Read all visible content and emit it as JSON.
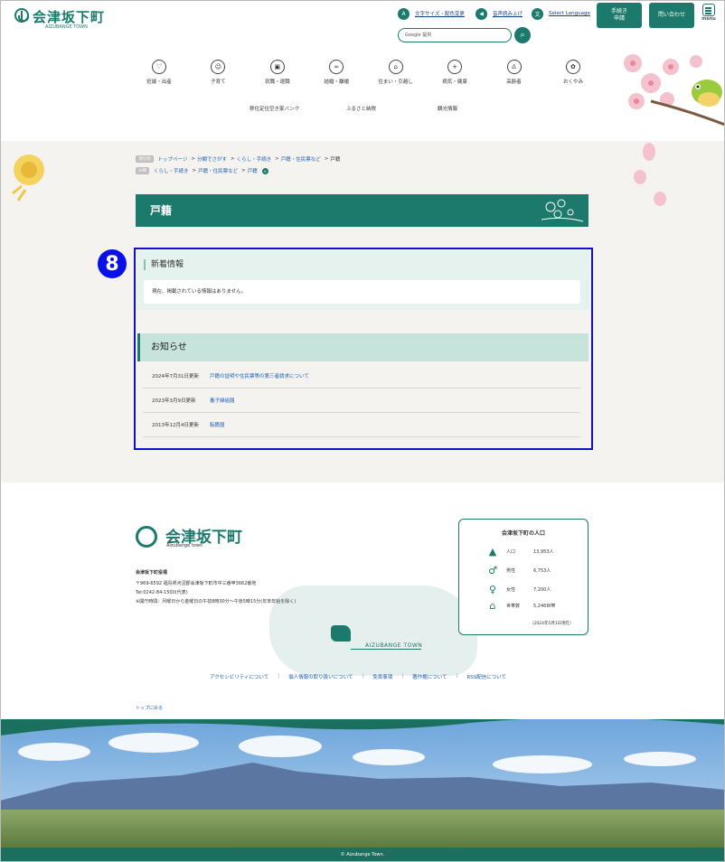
{
  "header": {
    "logo": {
      "name": "会津坂下町",
      "sub": "AIZUBANGE TOWN"
    },
    "tools": [
      {
        "icon": "text-size-icon",
        "glyph": "A",
        "label": "文字サイズ・配色変更"
      },
      {
        "icon": "speaker-icon",
        "glyph": "◀",
        "label": "音声読み上げ"
      },
      {
        "icon": "language-icon",
        "glyph": "文",
        "label": "Select Language"
      }
    ],
    "search": {
      "placeholder": "Google 提供"
    },
    "buttons": {
      "procedure": "手続き\n申請",
      "contact": "問い合わせ",
      "menu": "menu"
    }
  },
  "nav": [
    {
      "icon": "pregnancy-icon",
      "glyph": "♡",
      "label": "妊娠・出産"
    },
    {
      "icon": "child-icon",
      "glyph": "☺",
      "label": "子育て"
    },
    {
      "icon": "briefcase-icon",
      "glyph": "▣",
      "label": "就職・退職"
    },
    {
      "icon": "rings-icon",
      "glyph": "∞",
      "label": "結婚・離婚"
    },
    {
      "icon": "house-icon",
      "glyph": "⌂",
      "label": "住まい・引越し"
    },
    {
      "icon": "medical-bag-icon",
      "glyph": "+",
      "label": "病気・健康"
    },
    {
      "icon": "elderly-icon",
      "glyph": "♙",
      "label": "高齢者"
    },
    {
      "icon": "flower-icon",
      "glyph": "✿",
      "label": "おくやみ"
    }
  ],
  "subnav": [
    "移住定住空き家バンク",
    "ふるさと納税",
    "観光情報"
  ],
  "breadcrumb": {
    "current_tag": "現在地",
    "current": [
      "トップページ",
      "分類でさがす",
      "くらし・手続き",
      "戸籍・住民票など"
    ],
    "current_last": "戸籍",
    "classification_tag": "分類",
    "classification": [
      "くらし・手続き",
      "戸籍・住民票など",
      "戸籍"
    ],
    "separator": ">"
  },
  "page_title": "戸籍",
  "badge": "8",
  "news": {
    "heading": "新着情報",
    "empty": "現在、掲載されている情報はありません。"
  },
  "notices": {
    "heading": "お知らせ",
    "items": [
      {
        "date": "2024年7月31日更新",
        "title": "戸籍の証明や住民票等の第三者請求について"
      },
      {
        "date": "2023年3月9日更新",
        "title": "養子縁組届"
      },
      {
        "date": "2013年12月4日更新",
        "title": "転籍届"
      }
    ]
  },
  "footer": {
    "logo": {
      "name": "会津坂下町",
      "sub": "Aizubange town"
    },
    "office": "会津坂下町役場",
    "address": "〒969-6592 福島県河沼郡会津坂下町市中三番甲3662番地",
    "tel": "Tel:0242-84-1500(代表)",
    "hours": "※開庁時間：月曜日から金曜日の午前8時30分～午後5時15分(年末年始を除く)",
    "map_label": "AIZUBANGE TOWN",
    "population": {
      "title": "会津坂下町の人口",
      "rows": [
        {
          "icon": "people-icon",
          "glyph": "👪",
          "label": "人口",
          "value": "13,953人"
        },
        {
          "icon": "male-icon",
          "glyph": "♂",
          "label": "男性",
          "value": "6,753人"
        },
        {
          "icon": "female-icon",
          "glyph": "♀",
          "label": "女性",
          "value": "7,200人"
        },
        {
          "icon": "household-icon",
          "glyph": "⌂",
          "label": "世帯数",
          "value": "5,246世帯"
        }
      ],
      "date": "（2024年5月1日現在）"
    },
    "links": [
      "アクセシビリティについて",
      "個人情報の取り扱いについて",
      "免責事項",
      "著作権について",
      "RSS配信について"
    ],
    "to_top": "トップに戻る",
    "copyright": "© Aizubange Town."
  },
  "colors": {
    "accent": "#1b7a6b",
    "highlight": "#1010cc",
    "badge": "#0a10e8"
  }
}
